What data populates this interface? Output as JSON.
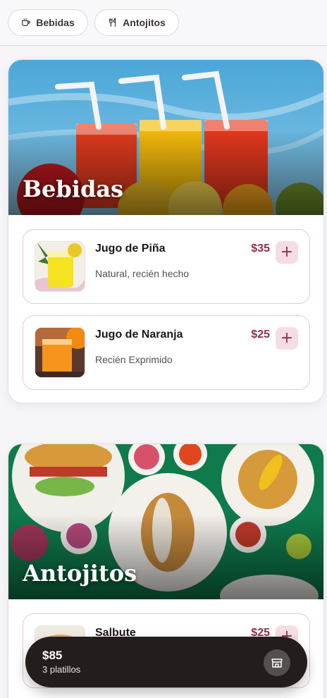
{
  "filters": [
    {
      "label": "Bebidas",
      "icon": "cup-icon"
    },
    {
      "label": "Antojitos",
      "icon": "utensils-icon"
    }
  ],
  "sections": [
    {
      "title": "Bebidas",
      "items": [
        {
          "name": "Jugo de Piña",
          "description": "Natural, recién hecho",
          "price": "$35"
        },
        {
          "name": "Jugo de Naranja",
          "description": "Recién Exprimido",
          "price": "$25"
        }
      ]
    },
    {
      "title": "Antojitos",
      "items": [
        {
          "name": "Salbute",
          "price": "$25"
        }
      ]
    }
  ],
  "add_label": "+",
  "cart": {
    "total": "$85",
    "count": "3 platillos",
    "icon": "store-icon"
  },
  "colors": {
    "accent": "#8e2e52",
    "accent_light": "#f6dde4",
    "cart_bg": "#231d1c"
  }
}
